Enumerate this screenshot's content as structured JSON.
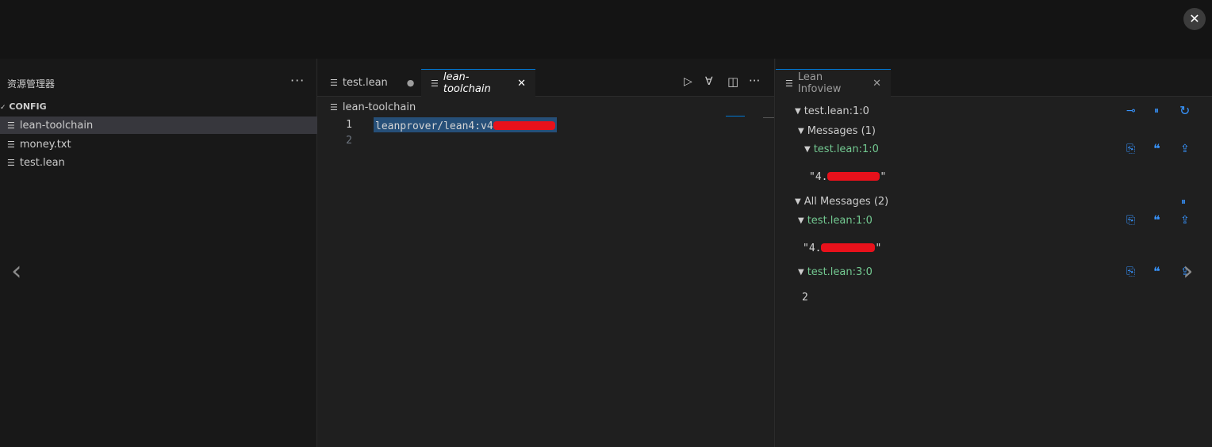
{
  "overlay": {
    "close_glyph": "✕"
  },
  "sidebar": {
    "title": "资源管理器",
    "more": "···",
    "section": "CONFIG",
    "files": [
      {
        "name": "lean-toolchain",
        "selected": true
      },
      {
        "name": "money.txt",
        "selected": false
      },
      {
        "name": "test.lean",
        "selected": false
      }
    ]
  },
  "editor": {
    "tabs": [
      {
        "label": "test.lean",
        "modified": "●"
      },
      {
        "label": "lean-toolchain",
        "close": "✕"
      }
    ],
    "actions": {
      "run": "▷",
      "merge": "∀",
      "split": "◫",
      "more": "···"
    },
    "breadcrumb": "lean-toolchain",
    "lines": [
      {
        "num": "1",
        "text": "leanprover/lean4:v4"
      },
      {
        "num": "2",
        "text": ""
      }
    ]
  },
  "infoview": {
    "tab_label": "Lean Infoview",
    "tab_close": "✕",
    "position": "test.lean:1:0",
    "messages_header": "Messages (1)",
    "message_1_loc": "test.lean:1:0",
    "message_1_value": "\"4.",
    "message_1_end": "\"",
    "all_messages_header": "All Messages (2)",
    "all_1_loc": "test.lean:1:0",
    "all_1_value": "\"4.",
    "all_1_end": "\"",
    "all_2_loc": "test.lean:3:0",
    "all_2_value": "2",
    "icons": {
      "pin": "⊸",
      "pause": "⏸",
      "refresh": "↻",
      "copy": "⎘",
      "quote": "❝",
      "goto": "⇪"
    }
  },
  "nav": {
    "prev": "‹",
    "next": "›"
  },
  "colors": {
    "accent": "#0078d4",
    "location_green": "#73c991",
    "icon_blue": "#3794ff",
    "redaction": "#e8111b"
  }
}
